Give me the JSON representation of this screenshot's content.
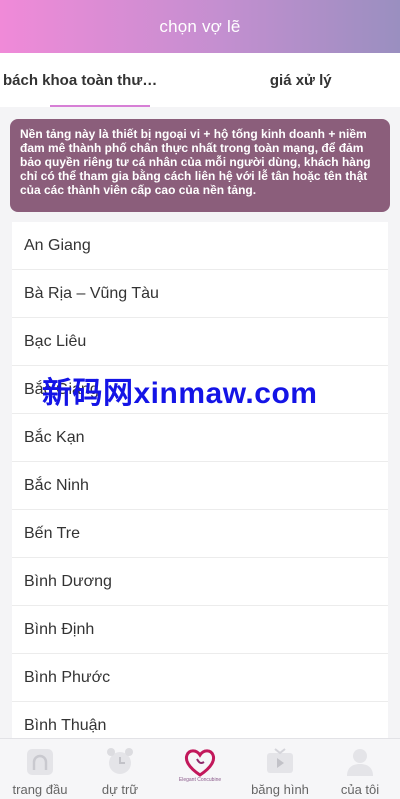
{
  "header": {
    "title": "chọn vợ lẽ"
  },
  "tabs": [
    {
      "label": "bách khoa toàn thư…",
      "active": true
    },
    {
      "label": "giá xử lý",
      "active": false
    }
  ],
  "notice": {
    "text": "Nền tảng này là thiết bị ngoại vi + hộ tống kinh doanh + niềm đam mê thành phố chân thực nhất trong toàn mạng, để đảm bảo quyền riêng tư cá nhân của mỗi người dùng, khách hàng chỉ có thể tham gia bằng cách liên hệ với lễ tân hoặc tên thật của các thành viên cấp cao của nền tảng."
  },
  "provinces": [
    "An Giang",
    "Bà Rịa – Vũng Tàu",
    "Bạc Liêu",
    "Bắc Giang",
    "Bắc Kạn",
    "Bắc Ninh",
    "Bến Tre",
    "Bình Dương",
    "Bình Định",
    "Bình Phước",
    "Bình Thuận"
  ],
  "watermark": "新码网xinmaw.com",
  "tabbar": {
    "home": "trang đầu",
    "reserve": "dự trữ",
    "center_brand": "Elegant Concubine",
    "video": "băng hình",
    "mine": "của tôi"
  },
  "colors": {
    "header_start": "#f08ad8",
    "header_end": "#9a8fc0",
    "notice_bg": "#8b5e7b",
    "tab_indicator": "#d77fd6",
    "watermark": "#1414e6"
  }
}
